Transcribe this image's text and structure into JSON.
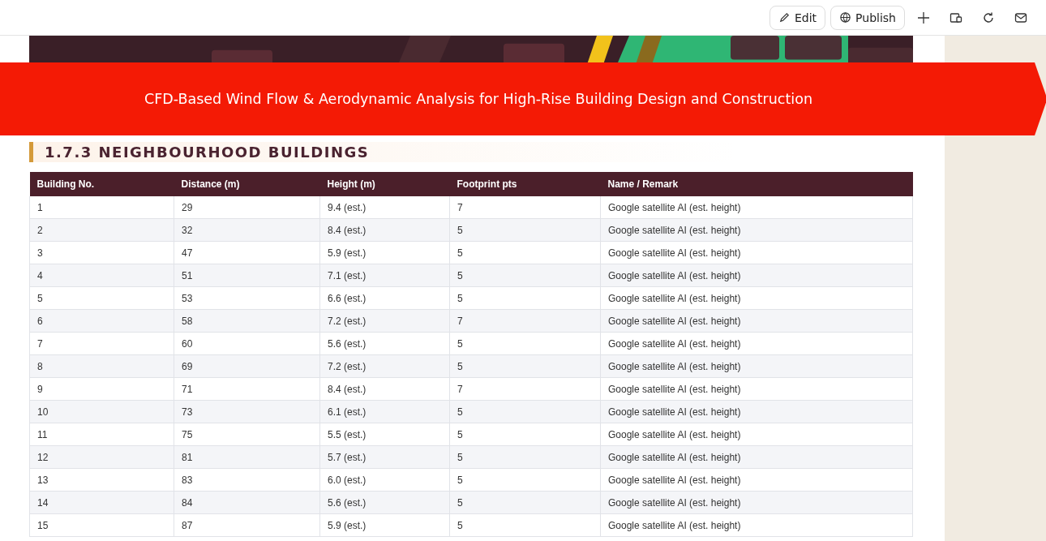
{
  "toolbar": {
    "buttons": [
      {
        "label": "Edit",
        "kind": "edit"
      },
      {
        "label": "Publish",
        "kind": "publish"
      }
    ]
  },
  "banner": {
    "title": "CFD-Based Wind Flow & Aerodynamic Analysis for High-Rise Building Design and Construction"
  },
  "section": {
    "heading": "1.7.3 NEIGHBOURHOOD BUILDINGS"
  },
  "table": {
    "columns": [
      "Building No.",
      "Distance (m)",
      "Height (m)",
      "Footprint pts",
      "Name / Remark"
    ],
    "rows": [
      [
        "1",
        "29",
        "9.4 (est.)",
        "7",
        "Google satellite AI (est. height)"
      ],
      [
        "2",
        "32",
        "8.4 (est.)",
        "5",
        "Google satellite AI (est. height)"
      ],
      [
        "3",
        "47",
        "5.9 (est.)",
        "5",
        "Google satellite AI (est. height)"
      ],
      [
        "4",
        "51",
        "7.1 (est.)",
        "5",
        "Google satellite AI (est. height)"
      ],
      [
        "5",
        "53",
        "6.6 (est.)",
        "5",
        "Google satellite AI (est. height)"
      ],
      [
        "6",
        "58",
        "7.2 (est.)",
        "7",
        "Google satellite AI (est. height)"
      ],
      [
        "7",
        "60",
        "5.6 (est.)",
        "5",
        "Google satellite AI (est. height)"
      ],
      [
        "8",
        "69",
        "7.2 (est.)",
        "5",
        "Google satellite AI (est. height)"
      ],
      [
        "9",
        "71",
        "8.4 (est.)",
        "7",
        "Google satellite AI (est. height)"
      ],
      [
        "10",
        "73",
        "6.1 (est.)",
        "5",
        "Google satellite AI (est. height)"
      ],
      [
        "11",
        "75",
        "5.5 (est.)",
        "5",
        "Google satellite AI (est. height)"
      ],
      [
        "12",
        "81",
        "5.7 (est.)",
        "5",
        "Google satellite AI (est. height)"
      ],
      [
        "13",
        "83",
        "6.0 (est.)",
        "5",
        "Google satellite AI (est. height)"
      ],
      [
        "14",
        "84",
        "5.6 (est.)",
        "5",
        "Google satellite AI (est. height)"
      ],
      [
        "15",
        "87",
        "5.9 (est.)",
        "5",
        "Google satellite AI (est. height)"
      ]
    ]
  }
}
